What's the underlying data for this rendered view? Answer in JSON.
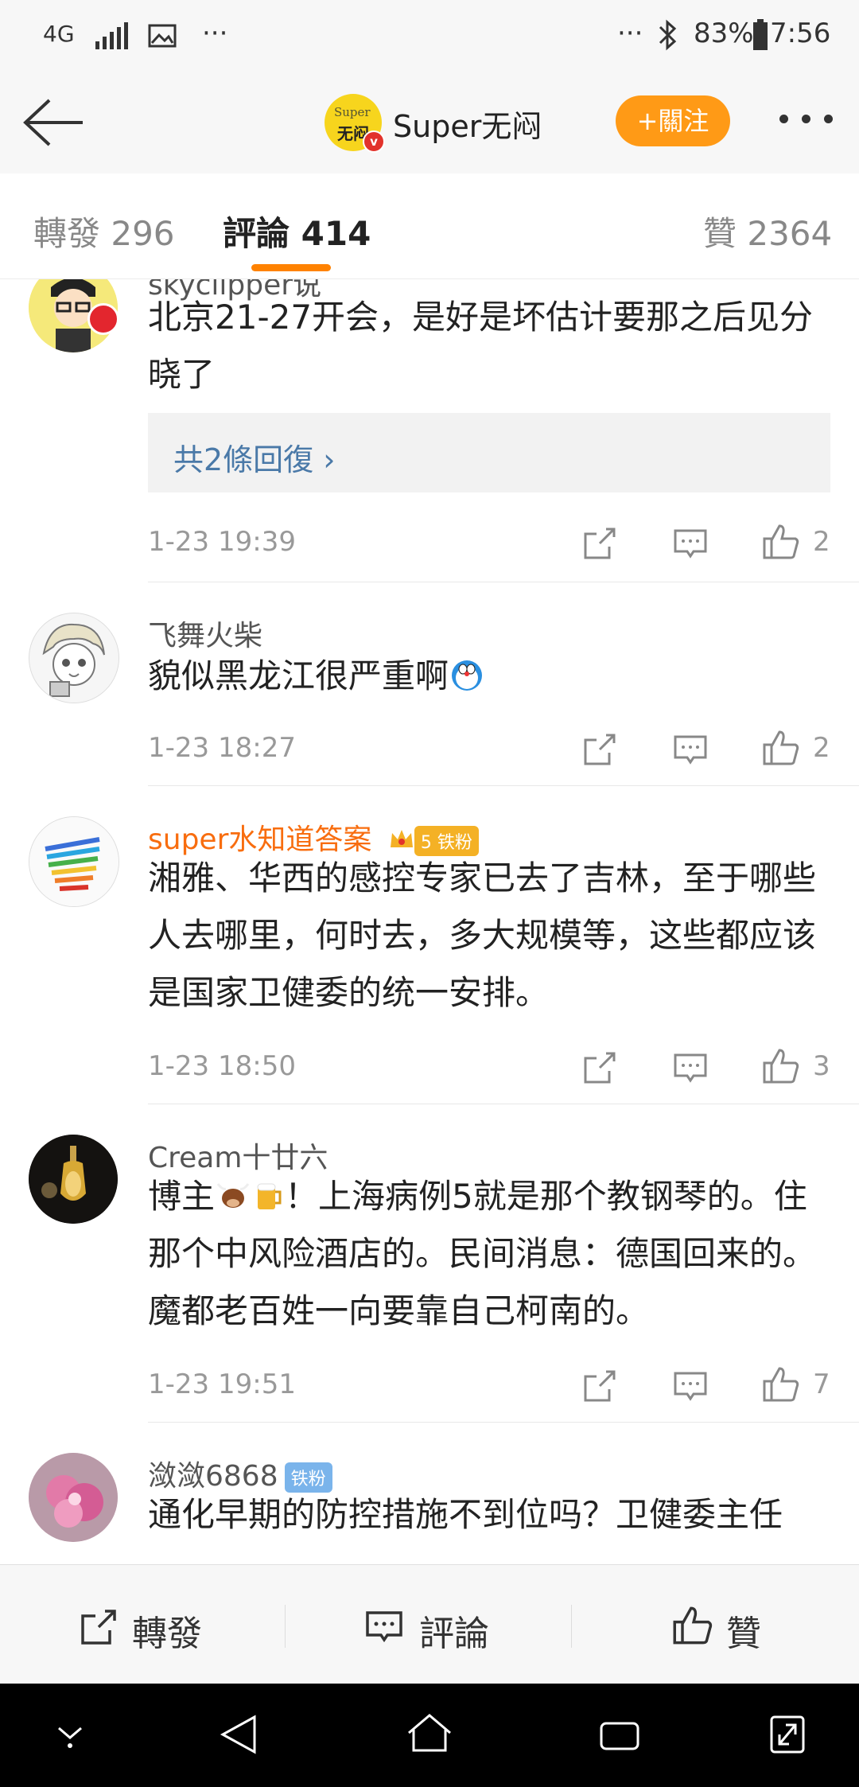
{
  "status_bar": {
    "network": "4G",
    "battery": "83%",
    "time": "7:56",
    "overflow": "···"
  },
  "header": {
    "logo_line1": "Super",
    "logo_line2": "无闷",
    "verified_mark": "v",
    "title": "Super无闷",
    "follow_label": "+關注"
  },
  "tabs": {
    "repost": "轉發 296",
    "comments": "評論 414",
    "likes": "贊 2364"
  },
  "comments": [
    {
      "username": "skyclipper说",
      "text": "北京21-27开会，是好是坏估计要那之后见分晓了",
      "replies": "共2條回復 ›",
      "time": "1-23 19:39",
      "likes": "2"
    },
    {
      "username": "飞舞火柴",
      "text": "貌似黑龙江很严重啊",
      "time": "1-23 18:27",
      "likes": "2"
    },
    {
      "username": "super水知道答案",
      "badge": "铁粉",
      "badge_level": "5",
      "text": "湘雅、华西的感控专家已去了吉林，至于哪些人去哪里，何时去，多大规模等，这些都应该是国家卫健委的统一安排。",
      "time": "1-23 18:50",
      "likes": "3"
    },
    {
      "username": "Cream十廿六",
      "text_before_emoji": "博主",
      "text_after_emoji": "！上海病例5就是那个教钢琴的。住那个中风险酒店的。民间消息：德国回来的。 魔都老百姓一向要靠自己柯南的。",
      "time": "1-23 19:51",
      "likes": "7"
    },
    {
      "username": "潋潋6868",
      "badge": "铁粉",
      "text": "通化早期的防控措施不到位吗？卫健委主任"
    }
  ],
  "bottom_bar": {
    "repost": "轉發",
    "comment": "評論",
    "like": "贊"
  },
  "colors": {
    "accent": "#ff8200",
    "follow_button": "#ff9a16",
    "vip_name": "#f86d0f",
    "link": "#4a79a8"
  }
}
